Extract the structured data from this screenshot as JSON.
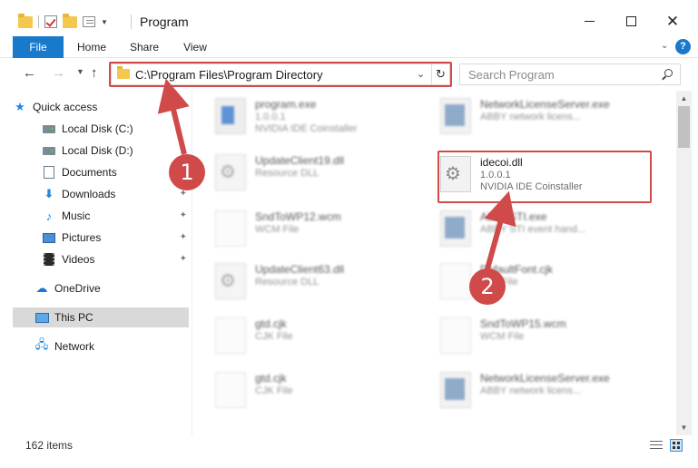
{
  "window": {
    "title": "Program",
    "controls": {
      "minimize": "–",
      "maximize": "□",
      "close": "✕"
    }
  },
  "ribbon": {
    "tabs": [
      {
        "label": "File"
      },
      {
        "label": "Home"
      },
      {
        "label": "Share"
      },
      {
        "label": "View"
      }
    ],
    "help": "?"
  },
  "address": {
    "path": "C:\\Program Files\\Program Directory",
    "refresh": "↻",
    "dropdown": "⌄"
  },
  "search": {
    "placeholder": "Search Program"
  },
  "nav": {
    "back": "←",
    "forward": "→",
    "recent": "⌄",
    "up": "↑"
  },
  "sidebar": {
    "items": [
      {
        "label": "Quick access",
        "icon": "star-icon",
        "pinned": false
      },
      {
        "label": "Local Disk (C:)",
        "icon": "disk-icon",
        "pinned": false
      },
      {
        "label": "Local Disk (D:)",
        "icon": "disk-icon",
        "pinned": false
      },
      {
        "label": "Documents",
        "icon": "document-icon",
        "pinned": false
      },
      {
        "label": "Downloads",
        "icon": "download-icon",
        "pinned": true
      },
      {
        "label": "Music",
        "icon": "music-icon",
        "pinned": true
      },
      {
        "label": "Pictures",
        "icon": "pictures-icon",
        "pinned": true
      },
      {
        "label": "Videos",
        "icon": "videos-icon",
        "pinned": true
      },
      {
        "label": "OneDrive",
        "icon": "cloud-icon",
        "pinned": false
      },
      {
        "label": "This PC",
        "icon": "computer-icon",
        "pinned": false,
        "selected": true
      },
      {
        "label": "Network",
        "icon": "network-icon",
        "pinned": false
      }
    ],
    "pin_glyph": "📌"
  },
  "files": [
    {
      "name": "program.exe",
      "line1": "1.0.0.1",
      "line2": "NVIDIA IDE Coinstaller",
      "icon": "app-icon"
    },
    {
      "name": "NetworkLicenseServer.exe",
      "line1": "ABBY network licens...",
      "line2": "",
      "icon": "exe-icon"
    },
    {
      "name": "UpdateClient19.dll",
      "line1": "Resource DLL",
      "line2": "",
      "icon": "dll-icon"
    },
    {
      "name": "idecoi.dll",
      "line1": "1.0.0.1",
      "line2": "NVIDIA IDE Coinstaller",
      "icon": "dll-icon"
    },
    {
      "name": "SndToWP12.wcm",
      "line1": "WCM File",
      "line2": "",
      "icon": "file-icon"
    },
    {
      "name": "ABBYSTI.exe",
      "line1": "ABBY STI event hand...",
      "line2": "",
      "icon": "exe-icon"
    },
    {
      "name": "UpdateClient63.dll",
      "line1": "Resource DLL",
      "line2": "",
      "icon": "dll-icon"
    },
    {
      "name": "DefaultFont.cjk",
      "line1": "CJK File",
      "line2": "",
      "icon": "file-icon"
    },
    {
      "name": "gtd.cjk",
      "line1": "CJK File",
      "line2": "",
      "icon": "file-icon"
    },
    {
      "name": "SndToWP15.wcm",
      "line1": "WCM File",
      "line2": "",
      "icon": "file-icon"
    },
    {
      "name": "gtd.cjk",
      "line1": "CJK File",
      "line2": "",
      "icon": "file-icon"
    },
    {
      "name": "NetworkLicenseServer.exe",
      "line1": "ABBY network licens...",
      "line2": "",
      "icon": "exe-icon"
    }
  ],
  "annotations": {
    "step1": "1",
    "step2": "2",
    "color": "#d04a4a"
  },
  "status": {
    "count": "162 items"
  },
  "colors": {
    "accent": "#1979ca",
    "selection": "#d9d9d9"
  }
}
